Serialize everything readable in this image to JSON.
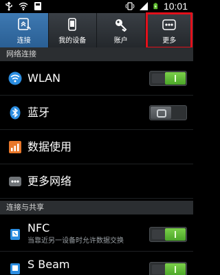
{
  "status_bar": {
    "time": "10:01",
    "icons": [
      "usb-icon",
      "wifi-icon",
      "storage-icon",
      "vibrate-icon",
      "signal-icon",
      "battery-icon"
    ]
  },
  "tabs": [
    {
      "label": "连接",
      "icon": "connection-icon",
      "active": true
    },
    {
      "label": "我的设备",
      "icon": "my-device-icon",
      "active": false
    },
    {
      "label": "账户",
      "icon": "account-key-icon",
      "active": false
    },
    {
      "label": "更多",
      "icon": "more-dots-icon",
      "active": false
    }
  ],
  "sections": {
    "network": "网络连接",
    "sharing": "连接与共享"
  },
  "rows": {
    "wlan": {
      "title": "WLAN",
      "toggle": "on"
    },
    "bluetooth": {
      "title": "蓝牙",
      "toggle": "off"
    },
    "data_usage": {
      "title": "数据使用"
    },
    "more_networks": {
      "title": "更多网络"
    },
    "nfc": {
      "title": "NFC",
      "subtitle": "当靠近另一设备时允许数据交换",
      "toggle": "on"
    },
    "sbeam": {
      "title": "S Beam",
      "subtitle": "",
      "toggle": "on"
    }
  },
  "colors": {
    "active_tab": "#3a72aa",
    "toggle_on": "#5bb833",
    "highlight": "#e3101b"
  }
}
